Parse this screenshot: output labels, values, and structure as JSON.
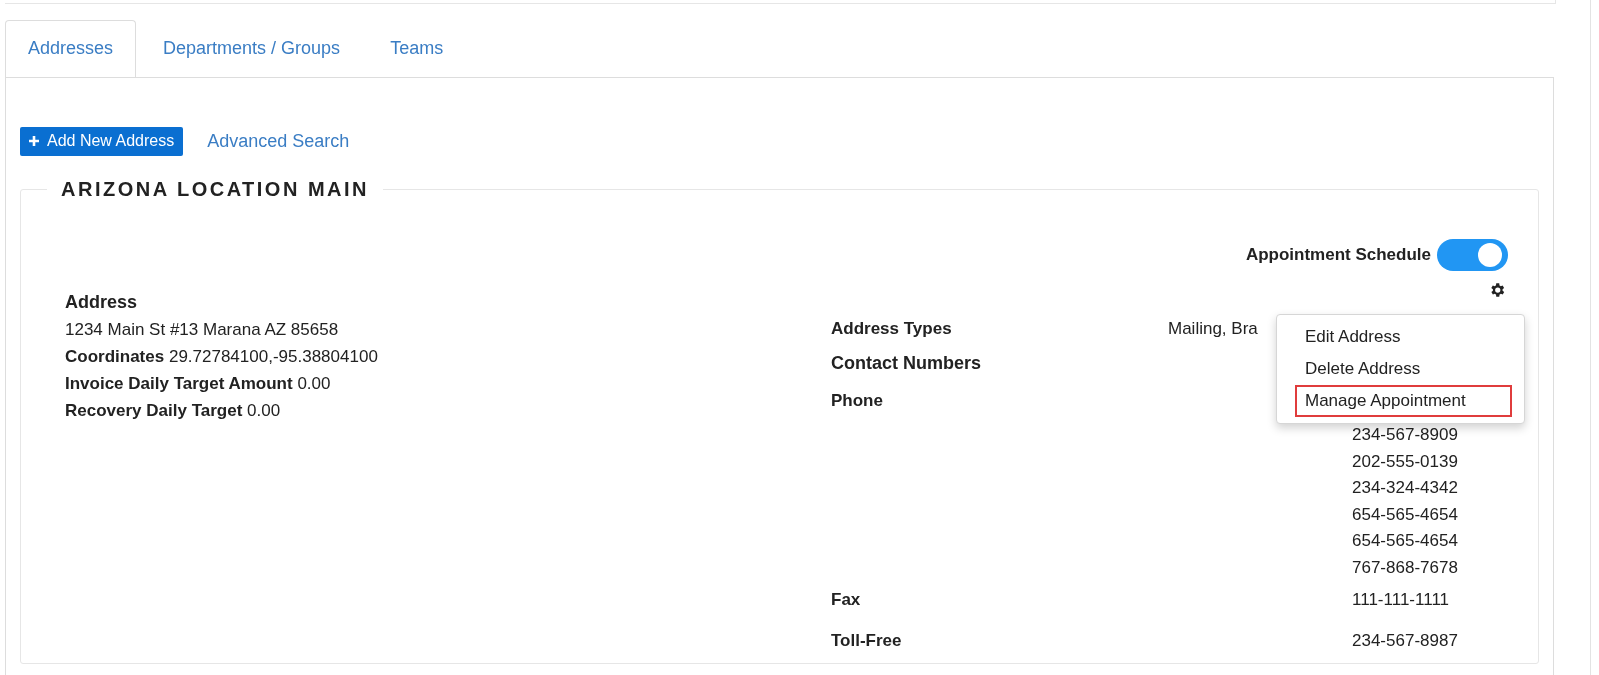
{
  "tabs": [
    {
      "label": "Addresses",
      "selected": true
    },
    {
      "label": "Departments / Groups",
      "selected": false
    },
    {
      "label": "Teams",
      "selected": false
    }
  ],
  "toolbar": {
    "add_button": "Add New Address",
    "search_link": "Advanced Search"
  },
  "location": {
    "title": "ARIZONA LOCATION MAIN",
    "appointment_schedule": {
      "label": "Appointment Schedule",
      "on": true
    },
    "address": {
      "heading": "Address",
      "line": "1234 Main St #13 Marana AZ 85658",
      "fields": [
        {
          "label": "Coordinates",
          "value": "29.72784100,-95.38804100"
        },
        {
          "label": "Invoice Daily Target Amount",
          "value": "0.00"
        },
        {
          "label": "Recovery Daily Target",
          "value": "0.00"
        }
      ]
    },
    "address_types": {
      "label": "Address Types",
      "value": "Mailing, Bra"
    },
    "contact_numbers": {
      "heading": "Contact Numbers",
      "groups": [
        {
          "label": "Phone",
          "numbers": [
            "234-567-8909",
            "202-555-0139",
            "234-324-4342",
            "654-565-4654",
            "654-565-4654",
            "767-868-7678"
          ]
        },
        {
          "label": "Fax",
          "numbers": [
            "111-111-1111"
          ]
        },
        {
          "label": "Toll-Free",
          "numbers": [
            "234-567-8987"
          ]
        }
      ]
    },
    "actions_menu": {
      "items": [
        {
          "label": "Edit Address",
          "highlighted": false
        },
        {
          "label": "Delete Address",
          "highlighted": false
        },
        {
          "label": "Manage Appointment",
          "highlighted": true
        }
      ]
    }
  }
}
